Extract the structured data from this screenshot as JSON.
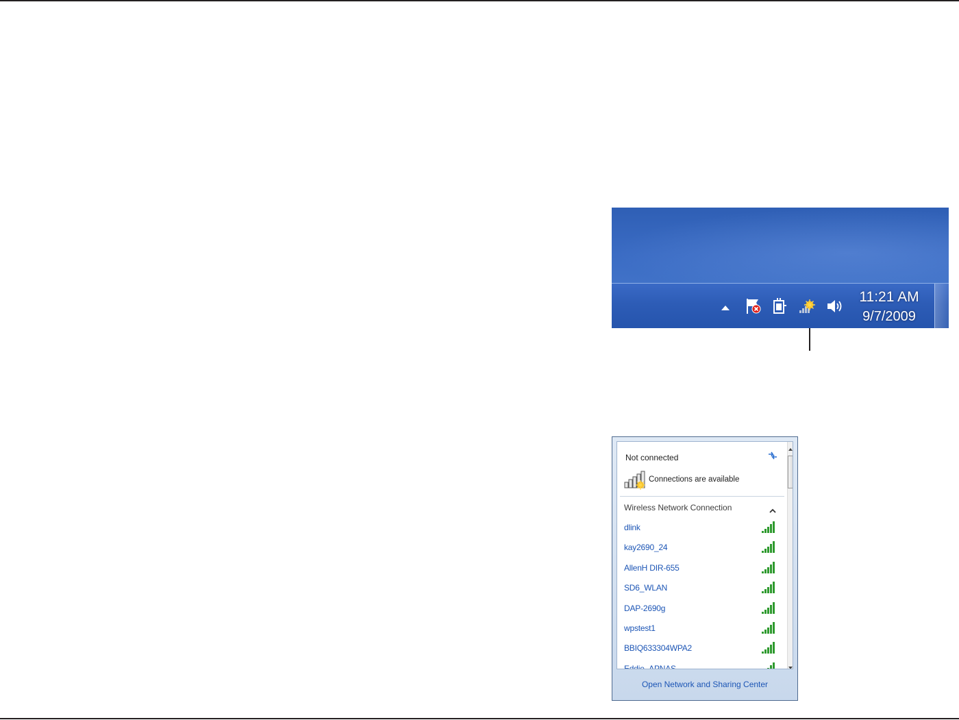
{
  "taskbar": {
    "time": "11:21 AM",
    "date": "9/7/2009",
    "icons": [
      "show-hidden-icons-arrow-icon",
      "action-center-flag-icon",
      "power-plug-icon",
      "wireless-network-icon",
      "speaker-volume-icon"
    ]
  },
  "flyout": {
    "status_title": "Not connected",
    "status_sub": "Connections are available",
    "section_header": "Wireless Network Connection",
    "networks": [
      {
        "name": "dlink"
      },
      {
        "name": "kay2690_24"
      },
      {
        "name": "AllenH DIR-655"
      },
      {
        "name": "SD6_WLAN"
      },
      {
        "name": "DAP-2690g"
      },
      {
        "name": "wpstest1"
      },
      {
        "name": "BBIQ633304WPA2"
      },
      {
        "name": "Eddie_APNAS"
      }
    ],
    "footer_link": "Open Network and Sharing Center"
  },
  "colors": {
    "link": "#1c55b5",
    "desktop_blue": "#3b6cc4",
    "signal_green": "#2e9a2e"
  }
}
